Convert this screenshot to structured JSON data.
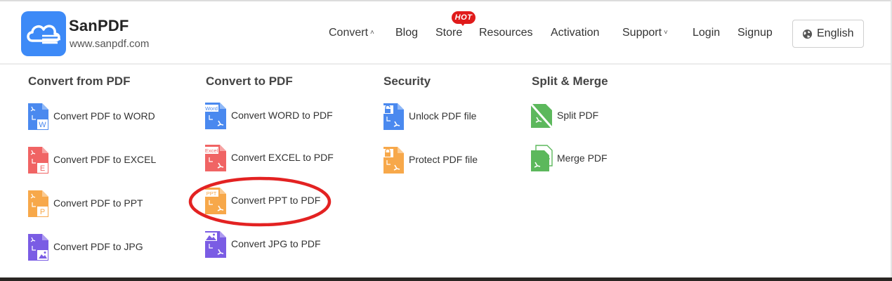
{
  "brand": {
    "name": "SanPDF",
    "url": "www.sanpdf.com"
  },
  "nav": {
    "convert": "Convert",
    "blog": "Blog",
    "store": "Store",
    "hot_badge": "HOT",
    "resources": "Resources",
    "activation": "Activation",
    "support": "Support",
    "login": "Login",
    "signup": "Signup",
    "language": "English"
  },
  "menu": {
    "from_pdf": {
      "title": "Convert from PDF",
      "items": [
        "Convert PDF to WORD",
        "Convert PDF to EXCEL",
        "Convert PDF to PPT",
        "Convert PDF to JPG"
      ]
    },
    "to_pdf": {
      "title": "Convert to PDF",
      "items": [
        "Convert WORD to PDF",
        "Convert EXCEL to PDF",
        "Convert PPT to PDF",
        "Convert JPG to PDF"
      ]
    },
    "security": {
      "title": "Security",
      "items": [
        "Unlock PDF file",
        "Protect PDF file"
      ]
    },
    "split_merge": {
      "title": "Split & Merge",
      "items": [
        "Split PDF",
        "Merge PDF"
      ]
    }
  },
  "icons": {
    "word_color": "#4a89ef",
    "excel_color": "#f06464",
    "ppt_color": "#f7a84a",
    "jpg_color": "#7a5ce4",
    "split_merge_color": "#5cb85c",
    "brand_color": "#3d8af7",
    "annotation_color": "#e32222",
    "icon_small_labels": {
      "word": "Word",
      "excel": "Excel",
      "ppt": "PPT"
    }
  }
}
